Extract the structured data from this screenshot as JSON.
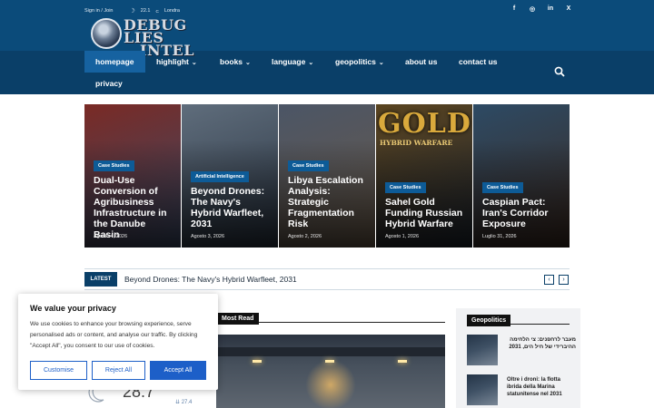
{
  "topbar": {
    "signin": "Sign in / Join",
    "temp": "22.1",
    "unit": "C",
    "city": "Londra",
    "socials": [
      {
        "icon": "facebook-icon",
        "glyph": "f"
      },
      {
        "icon": "instagram-icon",
        "glyph": "◎"
      },
      {
        "icon": "linkedin-icon",
        "glyph": "in"
      },
      {
        "icon": "x-twitter-icon",
        "glyph": "X"
      }
    ]
  },
  "logo": {
    "line1": "DEBUG LIES",
    "line2": "INTEL"
  },
  "nav": {
    "items": [
      {
        "label": "homepage",
        "dropdown": false,
        "active": true
      },
      {
        "label": "highlight",
        "dropdown": true
      },
      {
        "label": "books",
        "dropdown": true
      },
      {
        "label": "language",
        "dropdown": true
      },
      {
        "label": "geopolitics",
        "dropdown": true
      },
      {
        "label": "about us",
        "dropdown": false
      },
      {
        "label": "contact us",
        "dropdown": false
      },
      {
        "label": "privacy",
        "dropdown": false
      }
    ]
  },
  "cards": [
    {
      "badge": "Case Studies",
      "title": "Dual-Use Conversion of Agribusiness Infrastructure in the Danube Basin",
      "date": "Agosto 4, 2026",
      "colors": [
        "#7a2a25",
        "#3a4a66"
      ]
    },
    {
      "badge": "Artificial Intelligence",
      "title": "Beyond Drones: The Navy's Hybrid Warfleet, 2031",
      "date": "Agosto 3, 2026",
      "colors": [
        "#5f6d7c",
        "#28323f"
      ]
    },
    {
      "badge": "Case Studies",
      "title": "Libya Escalation Analysis: Strategic Fragmentation Risk",
      "date": "Agosto 2, 2026",
      "colors": [
        "#4b5566",
        "#6a5a48"
      ]
    },
    {
      "badge": "Case Studies",
      "title": "Sahel Gold Funding Russian Hybrid Warfare",
      "date": "Agosto 1, 2026",
      "colors": [
        "#5a4420",
        "#1d2530"
      ],
      "image_text": {
        "big": "GOLD",
        "small": "HYBRID WARFARE"
      }
    },
    {
      "badge": "Case Studies",
      "title": "Caspian Pact: Iran's Corridor Exposure",
      "date": "Luglio 31, 2026",
      "colors": [
        "#2d4a64",
        "#3d2a20"
      ]
    }
  ],
  "ticker": {
    "label": "LATEST",
    "text": "Beyond Drones: The Navy's Hybrid Warfleet, 2031",
    "prev": "‹",
    "next": "›"
  },
  "most_read": {
    "label": "Most Read"
  },
  "geopolitics": {
    "label": "Geopolitics",
    "items": [
      {
        "title": "מעבר לרחפנים: צי הלחימה ההיברידי של חיל הים, 2031"
      },
      {
        "title": "Oltre i droni: la flotta ibrida della Marina statunitense nel 2031"
      }
    ]
  },
  "weather": {
    "temp": "28.7",
    "low": "27.4"
  },
  "cookie": {
    "title": "We value your privacy",
    "body": "We use cookies to enhance your browsing experience, serve personalised ads or content, and analyse our traffic. By clicking \"Accept All\", you consent to our use of cookies.",
    "customise": "Customise",
    "reject": "Reject All",
    "accept": "Accept All"
  }
}
